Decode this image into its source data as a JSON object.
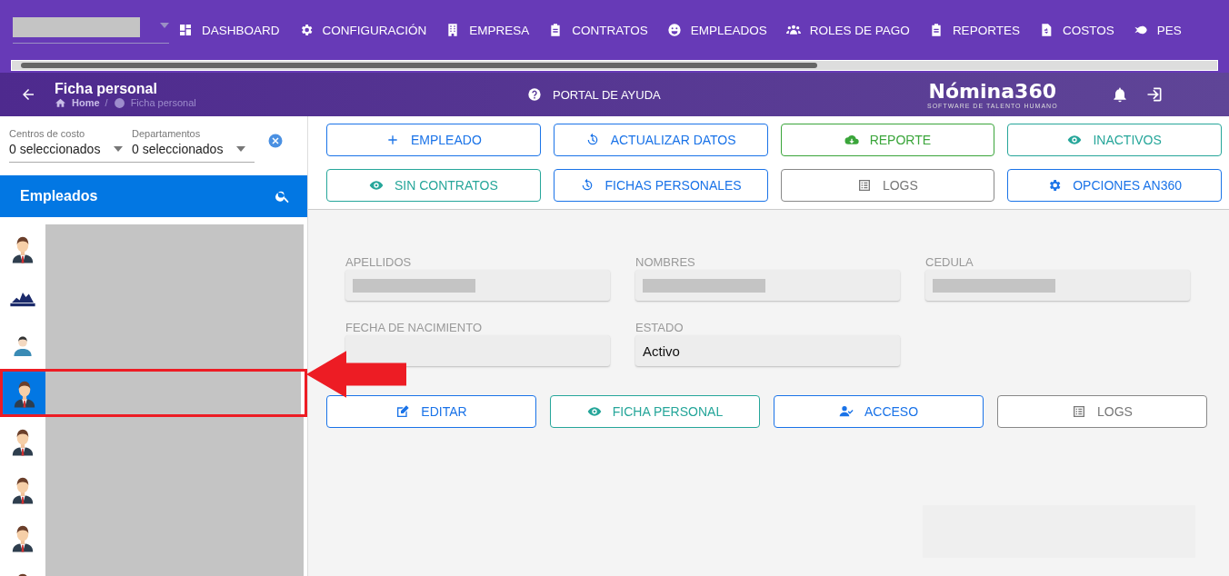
{
  "top_nav": {
    "items": [
      {
        "label": "DASHBOARD"
      },
      {
        "label": "CONFIGURACIÓN"
      },
      {
        "label": "EMPRESA"
      },
      {
        "label": "CONTRATOS"
      },
      {
        "label": "EMPLEADOS"
      },
      {
        "label": "ROLES DE PAGO"
      },
      {
        "label": "REPORTES"
      },
      {
        "label": "COSTOS"
      },
      {
        "label": "PES"
      }
    ]
  },
  "header": {
    "title": "Ficha personal",
    "breadcrumb": [
      "Home",
      "Ficha personal"
    ],
    "breadcrumb_separator": "/",
    "help_link": "PORTAL DE AYUDA",
    "logo": {
      "name": "Nómina360",
      "tagline": "SOFTWARE DE TALENTO HUMANO"
    }
  },
  "filters": [
    {
      "label": "Centros de costo",
      "value": "0 seleccionados"
    },
    {
      "label": "Departamentos",
      "value": "0 seleccionados"
    }
  ],
  "employees_panel": {
    "title": "Empleados",
    "rows": [
      {
        "kind": "avatar",
        "selected": false
      },
      {
        "kind": "logo",
        "selected": false
      },
      {
        "kind": "support",
        "selected": false
      },
      {
        "kind": "avatar",
        "selected": true
      },
      {
        "kind": "avatar",
        "selected": false
      },
      {
        "kind": "avatar",
        "selected": false
      },
      {
        "kind": "avatar",
        "selected": false
      },
      {
        "kind": "avatar",
        "selected": false
      }
    ]
  },
  "toolbar": [
    {
      "label": "EMPLEADO",
      "kind": "primary"
    },
    {
      "label": "ACTUALIZAR DATOS",
      "kind": "primary"
    },
    {
      "label": "REPORTE",
      "kind": "success"
    },
    {
      "label": "INACTIVOS",
      "kind": "teal"
    },
    {
      "label": "SIN CONTRATOS",
      "kind": "teal"
    },
    {
      "label": "FICHAS PERSONALES",
      "kind": "primary"
    },
    {
      "label": "LOGS",
      "kind": "neutral"
    },
    {
      "label": "OPCIONES AN360",
      "kind": "primary"
    }
  ],
  "fields": [
    {
      "label": "APELLIDOS",
      "kind": "redacted"
    },
    {
      "label": "NOMBRES",
      "kind": "redacted"
    },
    {
      "label": "CEDULA",
      "kind": "redacted"
    },
    {
      "label": "FECHA DE NACIMIENTO",
      "kind": "covered"
    },
    {
      "label": "ESTADO",
      "kind": "text",
      "value": "Activo"
    }
  ],
  "actions": [
    {
      "label": "EDITAR",
      "kind": "primary"
    },
    {
      "label": "FICHA PERSONAL",
      "kind": "teal"
    },
    {
      "label": "ACCESO",
      "kind": "primary"
    },
    {
      "label": "LOGS",
      "kind": "neutral"
    }
  ]
}
